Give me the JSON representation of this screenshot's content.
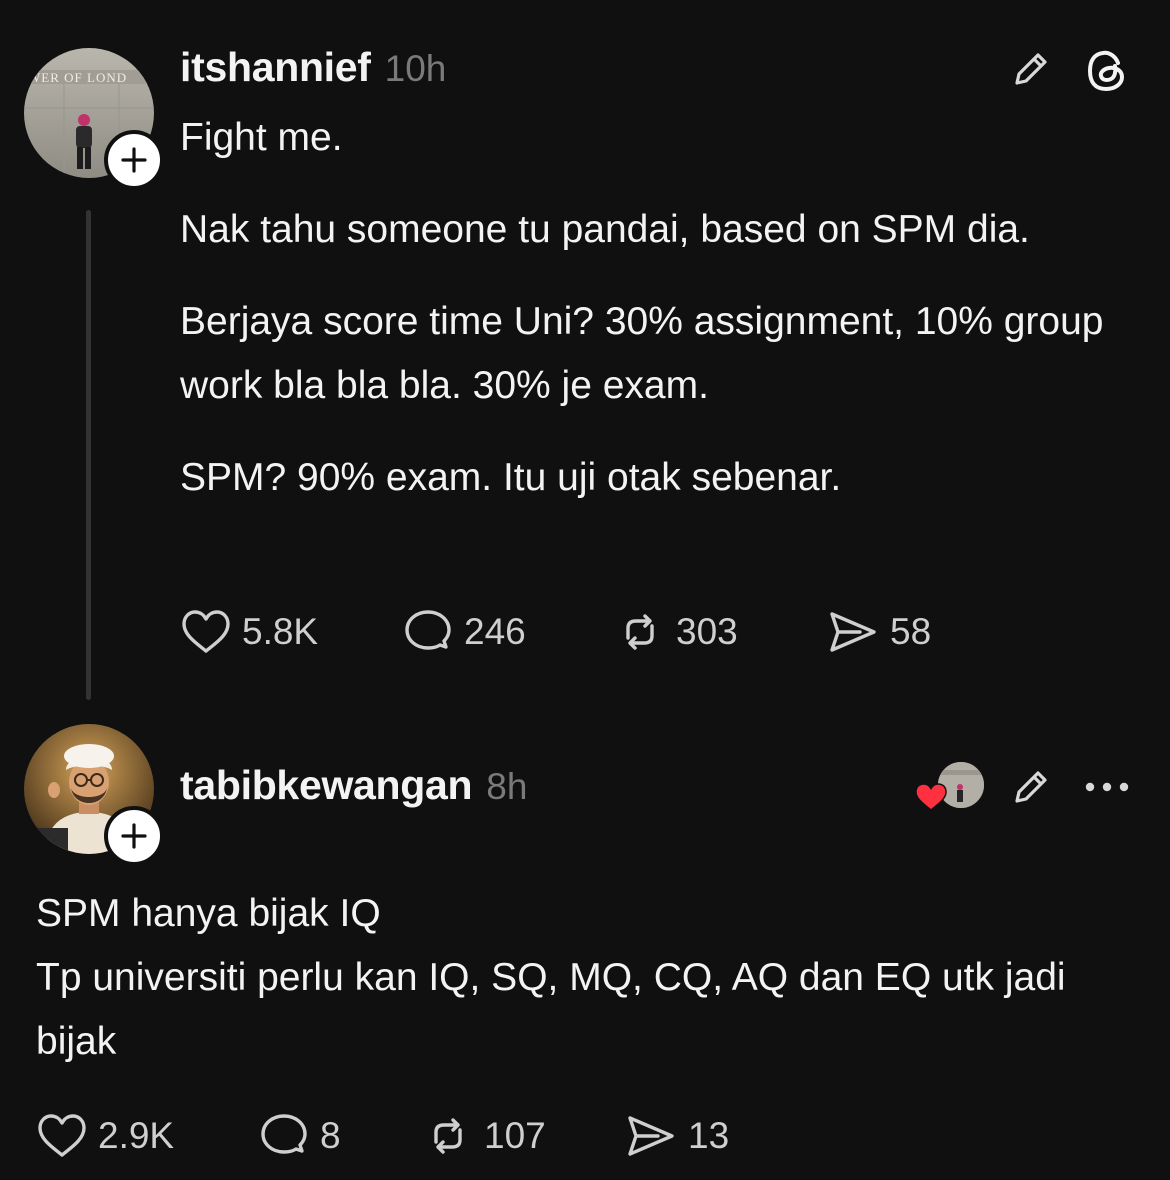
{
  "post1": {
    "username": "itshannief",
    "time": "10h",
    "avatar_text": "WER OF LOND",
    "paragraphs": [
      "Fight me.",
      "Nak tahu someone tu pandai, based on SPM dia.",
      "Berjaya score time Uni? 30% assignment, 10% group work bla bla bla. 30% je exam.",
      "SPM? 90% exam. Itu uji otak sebenar."
    ],
    "stats": {
      "likes": "5.8K",
      "replies": "246",
      "reposts": "303",
      "shares": "58"
    },
    "header_icons": [
      "edit-icon",
      "threads-logo-icon"
    ]
  },
  "post2": {
    "username": "tabibkewangan",
    "time": "8h",
    "lines": [
      "SPM hanya bijak IQ",
      "Tp universiti perlu kan IQ, SQ, MQ, CQ, AQ dan EQ utk jadi bijak"
    ],
    "stats": {
      "likes": "2.9K",
      "replies": "8",
      "reposts": "107",
      "shares": "13"
    },
    "header_icons": [
      "liked-by-author-avatar",
      "heart-icon",
      "edit-icon",
      "more-icon"
    ]
  },
  "colors": {
    "background": "#101010",
    "text": "#f3f3f3",
    "muted": "#7a7a7a",
    "heart": "#ff3040"
  }
}
